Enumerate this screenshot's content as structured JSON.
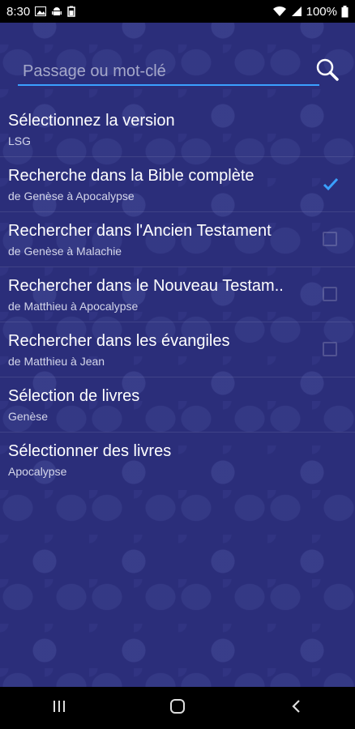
{
  "status_bar": {
    "time": "8:30",
    "battery": "100%",
    "icons": [
      "image-icon",
      "android-icon",
      "battery-saver-icon",
      "wifi-icon",
      "signal-icon",
      "battery-icon"
    ]
  },
  "search": {
    "placeholder": "Passage ou mot-clé",
    "value": "",
    "accent": "#3aa0ff"
  },
  "options": [
    {
      "title": "Sélectionnez la version",
      "subtitle": "LSG"
    },
    {
      "title": "Recherche dans la Bible complète",
      "subtitle": "de Genèse à Apocalypse",
      "checked": true
    },
    {
      "title": "Rechercher dans l'Ancien Testament",
      "subtitle": "de Genèse à Malachie",
      "checked": false
    },
    {
      "title": "Rechercher dans le Nouveau Testam..",
      "subtitle": "de Matthieu à Apocalypse",
      "checked": false
    },
    {
      "title": "Rechercher dans les évangiles",
      "subtitle": "de Matthieu à Jean",
      "checked": false
    },
    {
      "title": "Sélection de livres",
      "subtitle": "Genèse"
    },
    {
      "title": "Sélectionner des livres",
      "subtitle": "Apocalypse"
    }
  ],
  "nav_bar": {
    "buttons": [
      "recent-apps-icon",
      "home-icon",
      "back-icon"
    ]
  },
  "colors": {
    "background": "#2b2e7a",
    "check_accent": "#3aa0ff"
  }
}
